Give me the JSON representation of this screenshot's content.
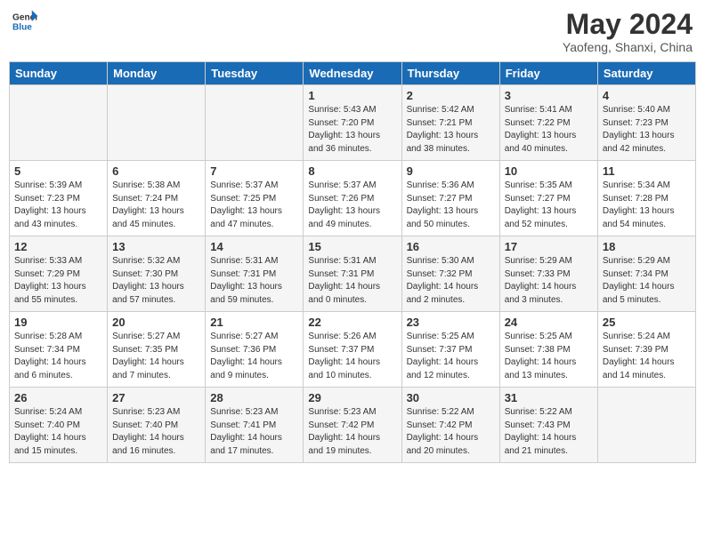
{
  "header": {
    "logo_line1": "General",
    "logo_line2": "Blue",
    "month": "May 2024",
    "location": "Yaofeng, Shanxi, China"
  },
  "days_of_week": [
    "Sunday",
    "Monday",
    "Tuesday",
    "Wednesday",
    "Thursday",
    "Friday",
    "Saturday"
  ],
  "weeks": [
    [
      {
        "day": "",
        "info": ""
      },
      {
        "day": "",
        "info": ""
      },
      {
        "day": "",
        "info": ""
      },
      {
        "day": "1",
        "info": "Sunrise: 5:43 AM\nSunset: 7:20 PM\nDaylight: 13 hours\nand 36 minutes."
      },
      {
        "day": "2",
        "info": "Sunrise: 5:42 AM\nSunset: 7:21 PM\nDaylight: 13 hours\nand 38 minutes."
      },
      {
        "day": "3",
        "info": "Sunrise: 5:41 AM\nSunset: 7:22 PM\nDaylight: 13 hours\nand 40 minutes."
      },
      {
        "day": "4",
        "info": "Sunrise: 5:40 AM\nSunset: 7:23 PM\nDaylight: 13 hours\nand 42 minutes."
      }
    ],
    [
      {
        "day": "5",
        "info": "Sunrise: 5:39 AM\nSunset: 7:23 PM\nDaylight: 13 hours\nand 43 minutes."
      },
      {
        "day": "6",
        "info": "Sunrise: 5:38 AM\nSunset: 7:24 PM\nDaylight: 13 hours\nand 45 minutes."
      },
      {
        "day": "7",
        "info": "Sunrise: 5:37 AM\nSunset: 7:25 PM\nDaylight: 13 hours\nand 47 minutes."
      },
      {
        "day": "8",
        "info": "Sunrise: 5:37 AM\nSunset: 7:26 PM\nDaylight: 13 hours\nand 49 minutes."
      },
      {
        "day": "9",
        "info": "Sunrise: 5:36 AM\nSunset: 7:27 PM\nDaylight: 13 hours\nand 50 minutes."
      },
      {
        "day": "10",
        "info": "Sunrise: 5:35 AM\nSunset: 7:27 PM\nDaylight: 13 hours\nand 52 minutes."
      },
      {
        "day": "11",
        "info": "Sunrise: 5:34 AM\nSunset: 7:28 PM\nDaylight: 13 hours\nand 54 minutes."
      }
    ],
    [
      {
        "day": "12",
        "info": "Sunrise: 5:33 AM\nSunset: 7:29 PM\nDaylight: 13 hours\nand 55 minutes."
      },
      {
        "day": "13",
        "info": "Sunrise: 5:32 AM\nSunset: 7:30 PM\nDaylight: 13 hours\nand 57 minutes."
      },
      {
        "day": "14",
        "info": "Sunrise: 5:31 AM\nSunset: 7:31 PM\nDaylight: 13 hours\nand 59 minutes."
      },
      {
        "day": "15",
        "info": "Sunrise: 5:31 AM\nSunset: 7:31 PM\nDaylight: 14 hours\nand 0 minutes."
      },
      {
        "day": "16",
        "info": "Sunrise: 5:30 AM\nSunset: 7:32 PM\nDaylight: 14 hours\nand 2 minutes."
      },
      {
        "day": "17",
        "info": "Sunrise: 5:29 AM\nSunset: 7:33 PM\nDaylight: 14 hours\nand 3 minutes."
      },
      {
        "day": "18",
        "info": "Sunrise: 5:29 AM\nSunset: 7:34 PM\nDaylight: 14 hours\nand 5 minutes."
      }
    ],
    [
      {
        "day": "19",
        "info": "Sunrise: 5:28 AM\nSunset: 7:34 PM\nDaylight: 14 hours\nand 6 minutes."
      },
      {
        "day": "20",
        "info": "Sunrise: 5:27 AM\nSunset: 7:35 PM\nDaylight: 14 hours\nand 7 minutes."
      },
      {
        "day": "21",
        "info": "Sunrise: 5:27 AM\nSunset: 7:36 PM\nDaylight: 14 hours\nand 9 minutes."
      },
      {
        "day": "22",
        "info": "Sunrise: 5:26 AM\nSunset: 7:37 PM\nDaylight: 14 hours\nand 10 minutes."
      },
      {
        "day": "23",
        "info": "Sunrise: 5:25 AM\nSunset: 7:37 PM\nDaylight: 14 hours\nand 12 minutes."
      },
      {
        "day": "24",
        "info": "Sunrise: 5:25 AM\nSunset: 7:38 PM\nDaylight: 14 hours\nand 13 minutes."
      },
      {
        "day": "25",
        "info": "Sunrise: 5:24 AM\nSunset: 7:39 PM\nDaylight: 14 hours\nand 14 minutes."
      }
    ],
    [
      {
        "day": "26",
        "info": "Sunrise: 5:24 AM\nSunset: 7:40 PM\nDaylight: 14 hours\nand 15 minutes."
      },
      {
        "day": "27",
        "info": "Sunrise: 5:23 AM\nSunset: 7:40 PM\nDaylight: 14 hours\nand 16 minutes."
      },
      {
        "day": "28",
        "info": "Sunrise: 5:23 AM\nSunset: 7:41 PM\nDaylight: 14 hours\nand 17 minutes."
      },
      {
        "day": "29",
        "info": "Sunrise: 5:23 AM\nSunset: 7:42 PM\nDaylight: 14 hours\nand 19 minutes."
      },
      {
        "day": "30",
        "info": "Sunrise: 5:22 AM\nSunset: 7:42 PM\nDaylight: 14 hours\nand 20 minutes."
      },
      {
        "day": "31",
        "info": "Sunrise: 5:22 AM\nSunset: 7:43 PM\nDaylight: 14 hours\nand 21 minutes."
      },
      {
        "day": "",
        "info": ""
      }
    ]
  ]
}
